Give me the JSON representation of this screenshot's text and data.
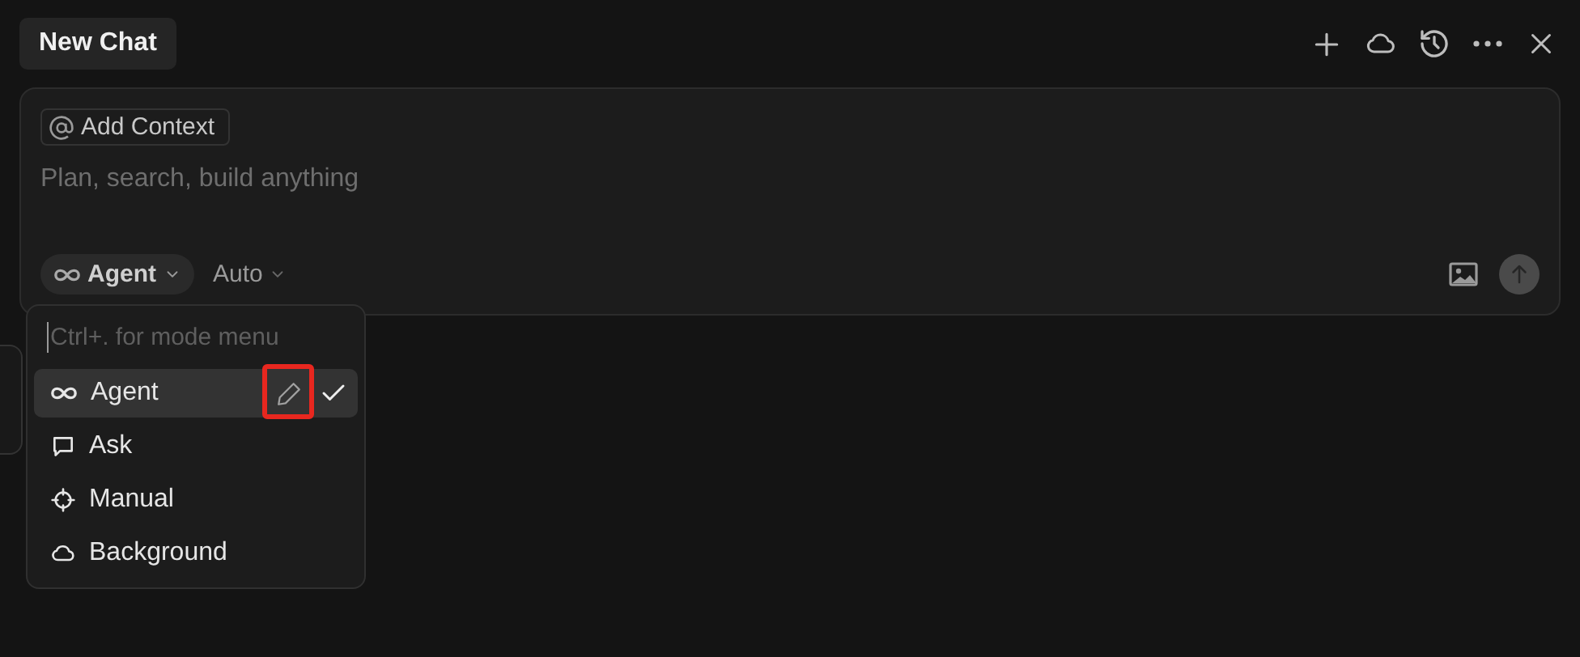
{
  "tab": {
    "title": "New Chat"
  },
  "composer": {
    "context_chip": "Add Context",
    "placeholder": "Plan, search, build anything",
    "mode": "Agent",
    "model": "Auto"
  },
  "mode_menu": {
    "placeholder": "Ctrl+. for mode menu",
    "items": [
      {
        "kind": "agent",
        "label": "Agent",
        "selected": true,
        "edit_annotated": true
      },
      {
        "kind": "ask",
        "label": "Ask",
        "selected": false,
        "edit_annotated": false
      },
      {
        "kind": "manual",
        "label": "Manual",
        "selected": false,
        "edit_annotated": false
      },
      {
        "kind": "background",
        "label": "Background",
        "selected": false,
        "edit_annotated": false
      }
    ]
  }
}
